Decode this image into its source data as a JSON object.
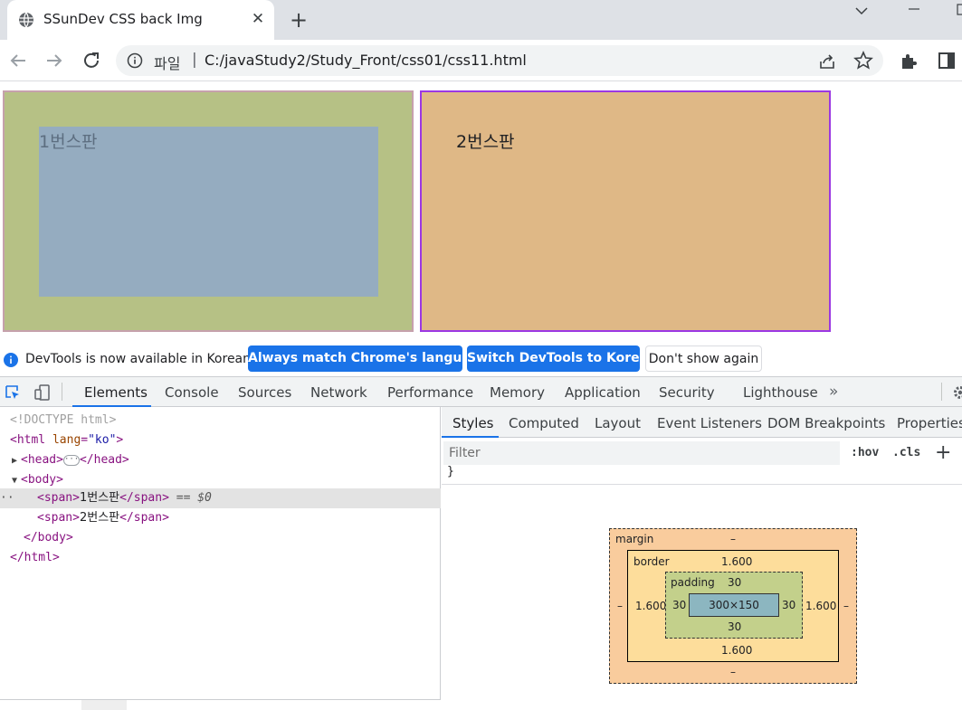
{
  "browser": {
    "tab_title": "SSunDev CSS back Img",
    "tab_close": "✕",
    "new_tab": "+",
    "url_scheme": "파일",
    "url": "C:/javaStudy2/Study_Front/css01/css11.html"
  },
  "page": {
    "panel1_label": "1번스판",
    "panel2_label": "2번스판",
    "colors": {
      "panel1_bg": "#b6c185",
      "panel1_inner": "#95acc0",
      "panel1_border": "#c6a1ac",
      "panel2_bg": "#dfb886",
      "panel2_border": "#9b38e3"
    }
  },
  "infobar": {
    "message": "DevTools is now available in Korean!",
    "btn_match": "Always match Chrome's language",
    "btn_switch": "Switch DevTools to Korean",
    "btn_dismiss": "Don't show again"
  },
  "devtools": {
    "tabs": [
      "Elements",
      "Console",
      "Sources",
      "Network",
      "Performance",
      "Memory",
      "Application",
      "Security",
      "Lighthouse"
    ],
    "more": "»",
    "dom": {
      "doctype": "<!DOCTYPE html>",
      "html_open": "<html",
      "lang_attr": "lang",
      "lang_val": "\"ko\"",
      "gt": ">",
      "head_open": "<head>",
      "head_close": "</head>",
      "body_open": "<body>",
      "span_open": "<span>",
      "span_close": "</span>",
      "span1_text": "1번스판",
      "span2_text": "2번스판",
      "selected_marker": "== $0",
      "dots": "··",
      "ellipsis": "···",
      "body_close": "</body>",
      "html_close": "</html>"
    },
    "styles_tabs": [
      "Styles",
      "Computed",
      "Layout",
      "Event Listeners",
      "DOM Breakpoints",
      "Properties"
    ],
    "filter_placeholder": "Filter",
    "hov": ":hov",
    "cls": ".cls",
    "plus": "+",
    "brace": "}",
    "box_model": {
      "margin_label": "margin",
      "margin_top": "–",
      "margin_bottom": "–",
      "margin_left": "–",
      "margin_right": "–",
      "border_label": "border",
      "border_top": "1.600",
      "border_bottom": "1.600",
      "border_left": "1.600",
      "border_right": "1.600",
      "padding_label": "padding",
      "padding_top": "30",
      "padding_bottom": "30",
      "padding_left": "30",
      "padding_right": "30",
      "content": "300×150"
    }
  }
}
